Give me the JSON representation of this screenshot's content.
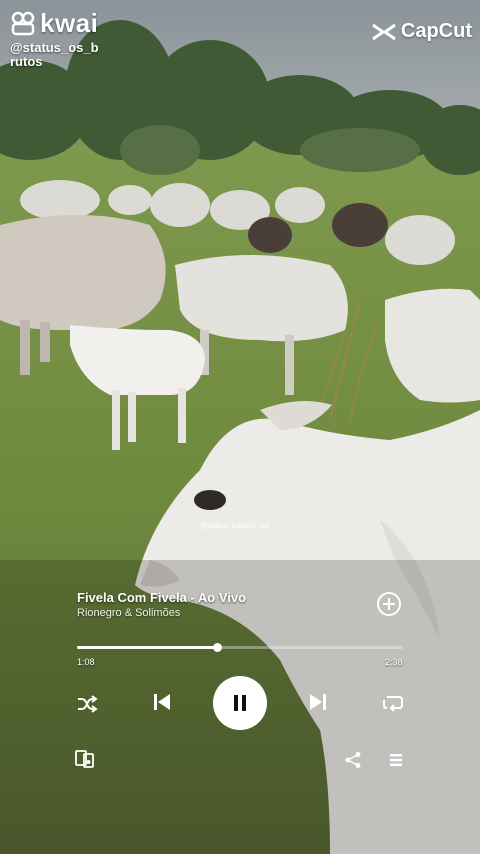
{
  "overlay": {
    "kwai_brand": "kwai",
    "kwai_username": "@status_os_brutos",
    "capcut_brand": "CapCut",
    "video_watermark": "@status.caipira_mt"
  },
  "player": {
    "song_title": "Fivela Com Fivela - Ao Vivo",
    "artist": "Rionegro & Solimões",
    "current_time": "1:08",
    "total_time": "2:38",
    "progress_fraction": 0.43,
    "is_playing": true,
    "buttons": {
      "add": "plus-circle-icon",
      "shuffle": "shuffle-icon",
      "previous": "skip-previous-icon",
      "pause": "pause-icon",
      "next": "skip-next-icon",
      "repeat": "repeat-icon",
      "connect_device": "connect-device-icon",
      "share": "share-icon",
      "queue": "queue-icon"
    }
  },
  "colors": {
    "accent": "#ffffff",
    "track_bg": "#ffffff59"
  }
}
